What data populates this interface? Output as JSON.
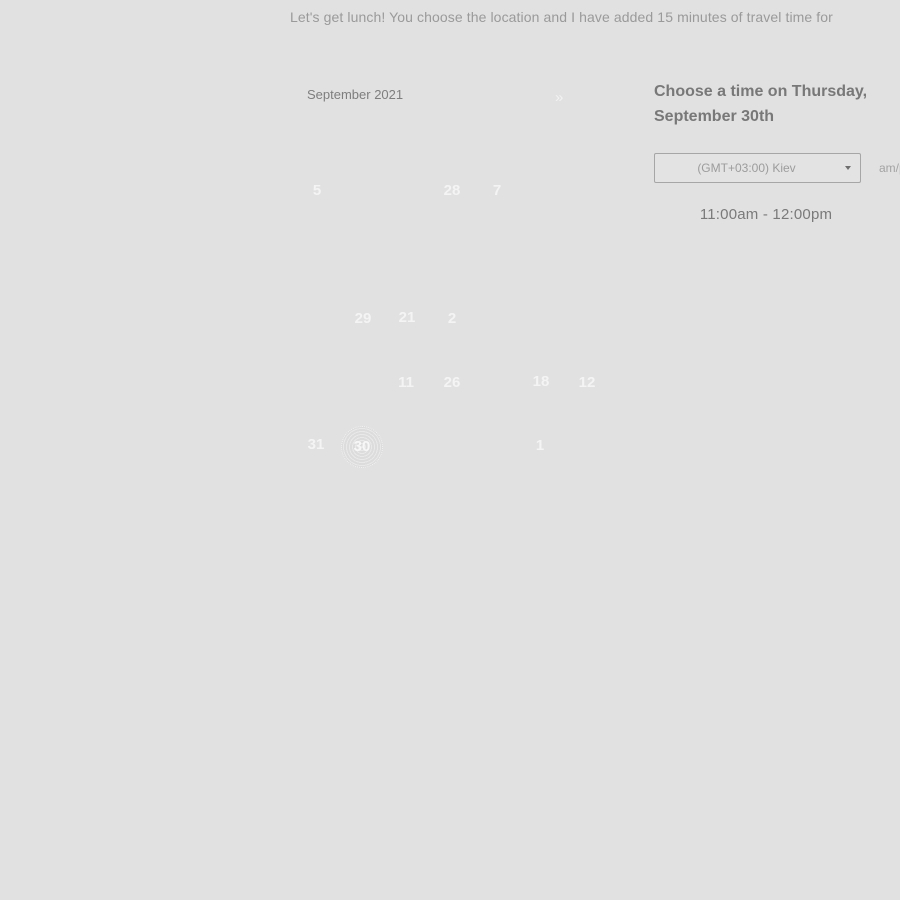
{
  "intro": {
    "text": "Let's get lunch! You choose the location and I have added 15 minutes of travel time for"
  },
  "calendar": {
    "month_label": "September 2021",
    "next_icon": "»",
    "days": [
      {
        "label": "5"
      },
      {
        "label": "28"
      },
      {
        "label": "7"
      },
      {
        "label": "29"
      },
      {
        "label": "21"
      },
      {
        "label": "2"
      },
      {
        "label": "11"
      },
      {
        "label": "26"
      },
      {
        "label": "18"
      },
      {
        "label": "12"
      },
      {
        "label": "31"
      },
      {
        "label": "30",
        "selected": true
      },
      {
        "label": "1"
      }
    ]
  },
  "scheduler": {
    "heading": "Choose a time on Thursday, September 30th",
    "timezone": "(GMT+03:00) Kiev",
    "format_toggle": "am/pm",
    "slots": [
      "11:00am - 12:00pm"
    ]
  }
}
